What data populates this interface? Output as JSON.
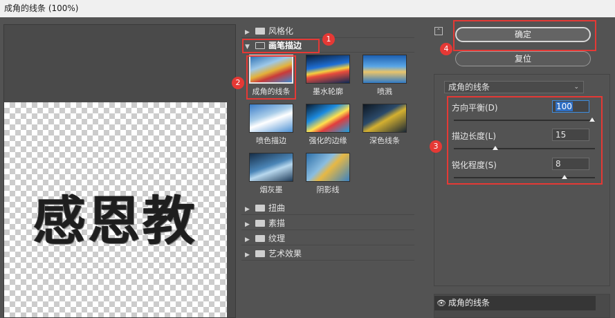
{
  "window": {
    "title": "成角的线条 (100%)"
  },
  "preview": {
    "text": "感恩教"
  },
  "filter_tree": {
    "folders_top": [
      {
        "label": "风格化",
        "expanded": false
      },
      {
        "label": "画笔描边",
        "expanded": true
      }
    ],
    "thumbnails": [
      {
        "label": "成角的线条",
        "selected": true
      },
      {
        "label": "墨水轮廓"
      },
      {
        "label": "喷溅"
      },
      {
        "label": "喷色描边"
      },
      {
        "label": "强化的边缘"
      },
      {
        "label": "深色线条"
      },
      {
        "label": "烟灰墨"
      },
      {
        "label": "阴影线"
      }
    ],
    "folders_bottom": [
      {
        "label": "扭曲"
      },
      {
        "label": "素描"
      },
      {
        "label": "纹理"
      },
      {
        "label": "艺术效果"
      }
    ]
  },
  "buttons": {
    "ok": "确定",
    "reset": "复位"
  },
  "settings": {
    "filter_select": "成角的线条",
    "params": [
      {
        "label": "方向平衡(D)",
        "value": "100",
        "slider_fraction": 1.0
      },
      {
        "label": "描边长度(L)",
        "value": "15",
        "slider_fraction": 0.3
      },
      {
        "label": "锐化程度(S)",
        "value": "8",
        "slider_fraction": 0.8
      }
    ]
  },
  "layers": {
    "items": [
      {
        "label": "成角的线条",
        "visible": true
      }
    ]
  },
  "annotations": {
    "badges": [
      "1",
      "2",
      "3",
      "4"
    ],
    "color": "#e53935"
  },
  "icons": {
    "folder": "folder-icon",
    "eye": "eye-icon",
    "collapse": "collapse-icon"
  }
}
